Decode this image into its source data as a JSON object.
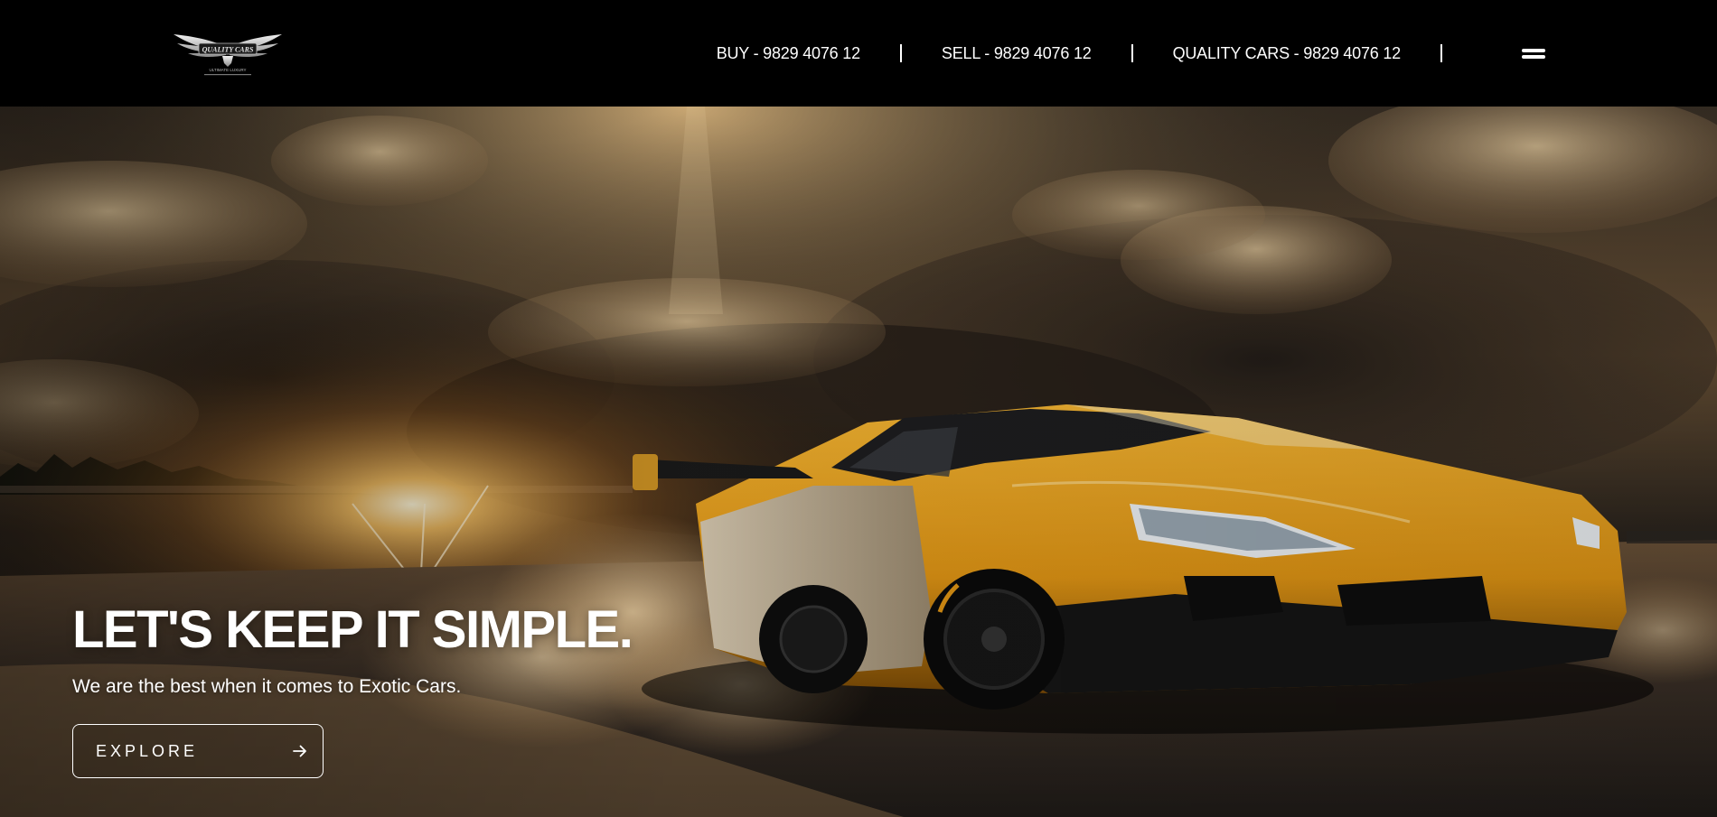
{
  "header": {
    "logo_text": "QUALITY CARS",
    "logo_subtext": "ULTIMATE LUXURY",
    "nav": [
      {
        "label": "BUY - 9829 4076 12"
      },
      {
        "label": "SELL - 9829 4076 12"
      },
      {
        "label": "QUALITY CARS - 9829 4076 12"
      }
    ],
    "separator": "|",
    "menu_icon": "hamburger-icon"
  },
  "hero": {
    "title": "LET'S KEEP IT SIMPLE.",
    "subtitle": "We are the best when it comes to Exotic Cars.",
    "cta": {
      "label": "EXPLORE",
      "icon": "arrow-right-icon"
    },
    "background": "Yellow supercar drifting on a race track under a dramatic sunset sky"
  },
  "colors": {
    "header_bg": "#000000",
    "text": "#ffffff",
    "car_accent": "#e8a41c"
  }
}
